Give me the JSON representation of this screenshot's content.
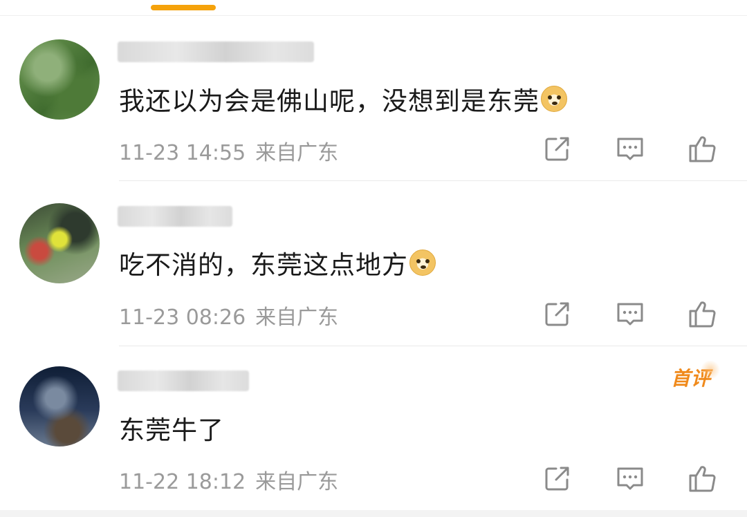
{
  "comments": [
    {
      "text": "我还以为会是佛山呢，没想到是东莞",
      "time": "11-23 14:55",
      "location": "来自广东",
      "emoji": "doge-emoji",
      "first": false
    },
    {
      "text": "吃不消的，东莞这点地方",
      "time": "11-23 08:26",
      "location": "来自广东",
      "emoji": "doge-emoji",
      "first": false
    },
    {
      "text": "东莞牛了",
      "time": "11-22 18:12",
      "location": "来自广东",
      "emoji": null,
      "first": true,
      "badge": "首评"
    }
  ],
  "icons": {
    "share": "share-icon",
    "reply": "comment-icon",
    "like": "thumbs-up-icon"
  },
  "colors": {
    "accent": "#f5a20b",
    "badge": "#f08a1c",
    "meta": "#9a9a9a",
    "text": "#1a1a1a"
  }
}
